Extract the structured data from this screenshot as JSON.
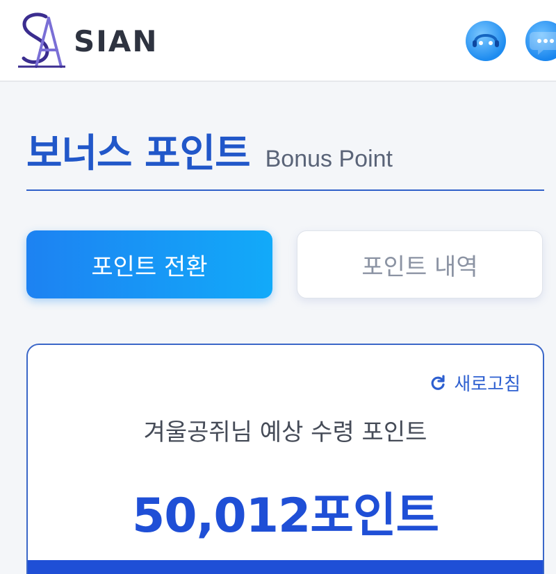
{
  "header": {
    "brand": "SIAN",
    "icons": [
      "support-agent-icon",
      "chat-bubble-icon"
    ]
  },
  "page": {
    "title": "보너스 포인트",
    "subtitle": "Bonus Point"
  },
  "tabs": [
    {
      "label": "포인트 전환",
      "active": true
    },
    {
      "label": "포인트 내역",
      "active": false
    }
  ],
  "card": {
    "refresh_label": "새로고침",
    "expected_label": "겨울공쥐님 예상 수령 포인트",
    "points_value": "50,012포인트"
  },
  "colors": {
    "accent": "#2157c9",
    "tab_active": "#1d82f2",
    "points": "#1f4fd6"
  }
}
